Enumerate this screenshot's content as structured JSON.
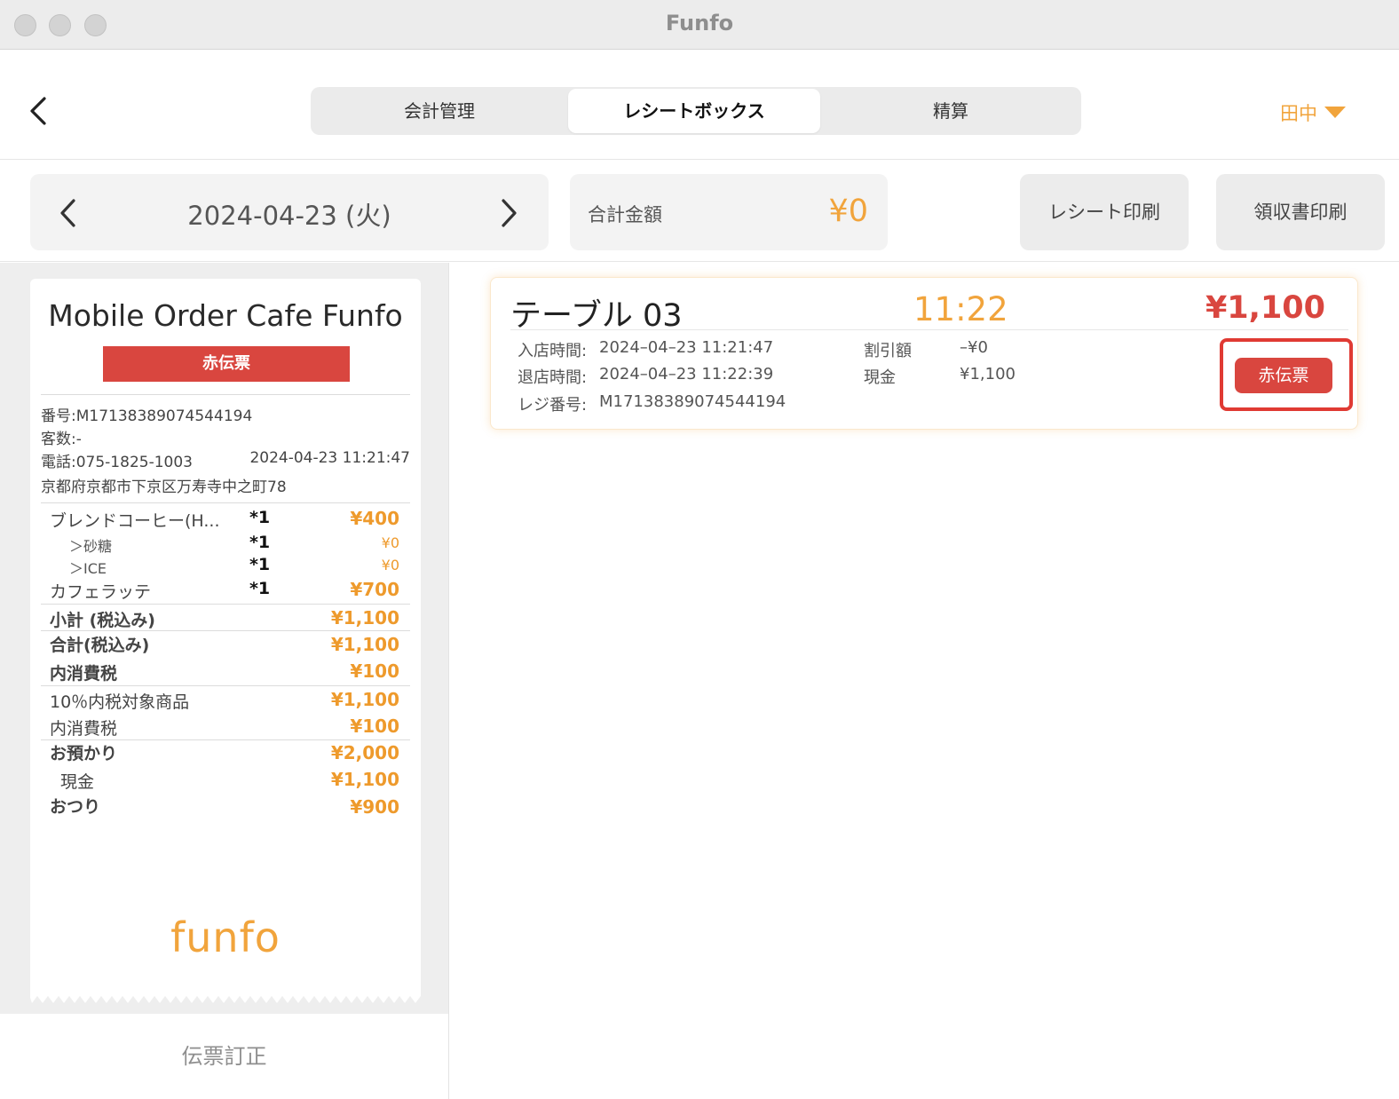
{
  "window": {
    "title": "Funfo"
  },
  "header": {
    "tabs": [
      {
        "label": "会計管理"
      },
      {
        "label": "レシートボックス"
      },
      {
        "label": "精算"
      }
    ],
    "user": "田中"
  },
  "toolbar": {
    "date": "2024-04-23 (火)",
    "total_label": "合計金額",
    "total_value": "¥0",
    "receipt_print": "レシート印刷",
    "invoice_print": "領収書印刷"
  },
  "receipt": {
    "shop_name": "Mobile Order Cafe Funfo",
    "badge": "赤伝票",
    "number": "番号:M17138389074544194",
    "guests": "客数:-",
    "phone": "電話:075-1825-1003",
    "datetime": "2024-04-23 11:21:47",
    "address": "京都府京都市下京区万寿寺中之町78",
    "items": [
      {
        "name": "ブレンドコーヒー(H...",
        "qty": "*1",
        "price": "¥400"
      },
      {
        "name": "＞砂糖",
        "qty": "*1",
        "price": "¥0"
      },
      {
        "name": "＞ICE",
        "qty": "*1",
        "price": "¥0"
      },
      {
        "name": "カフェラッテ",
        "qty": "*1",
        "price": "¥700"
      }
    ],
    "subtotal_label": "小計 (税込み)",
    "subtotal": "¥1,100",
    "total_label": "合計(税込み)",
    "total": "¥1,100",
    "tax_label": "内消費税",
    "tax": "¥100",
    "taxable_label": "10％内税対象商品",
    "taxable": "¥1,100",
    "tax2_label": "内消費税",
    "tax2": "¥100",
    "deposit_label": "お預かり",
    "deposit": "¥2,000",
    "cash_label": "現金",
    "cash": "¥1,100",
    "change_label": "おつり",
    "change": "¥900",
    "logo": "funfo"
  },
  "correction_label": "伝票訂正",
  "order_card": {
    "table": "テーブル 03",
    "time": "11:22",
    "amount": "¥1,100",
    "entry_label": "入店時間:",
    "entry_value": "2024–04–23 11:21:47",
    "exit_label": "退店時間:",
    "exit_value": "2024–04–23 11:22:39",
    "register_label": "レジ番号:",
    "register_value": "M17138389074544194",
    "discount_label": "割引額",
    "discount_value": "–¥0",
    "cash_label": "現金",
    "cash_value": "¥1,100",
    "red_slip_button": "赤伝票"
  },
  "colors": {
    "accent": "#f1a43c",
    "red": "#d9463f",
    "highlight": "#e03a33"
  }
}
